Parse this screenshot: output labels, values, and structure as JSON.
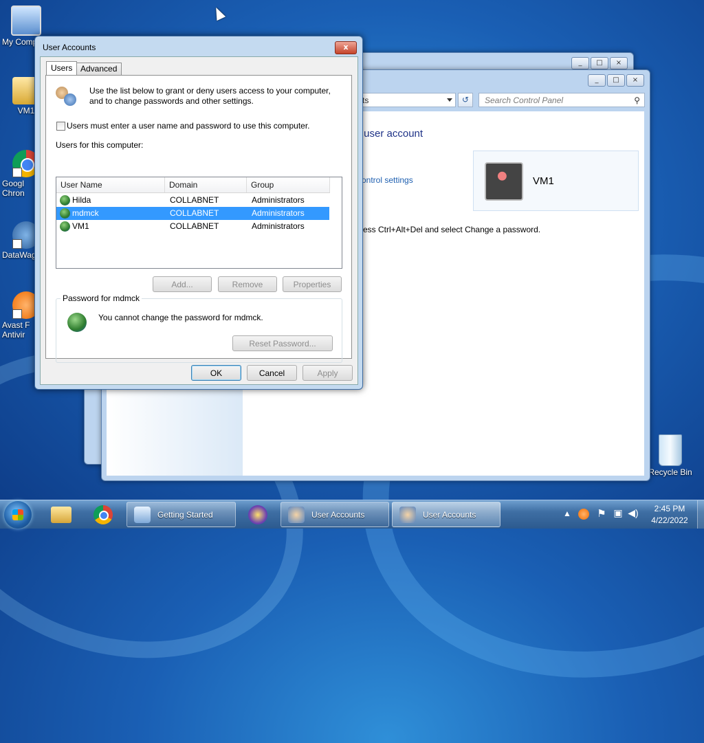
{
  "desktop": {
    "icons": [
      {
        "label": "My Comp",
        "icon": "computer-icon"
      },
      {
        "label": "VM1",
        "icon": "user-folder-icon"
      },
      {
        "label": "Google Chrom",
        "line1": "Googl",
        "line2": "Chron",
        "icon": "chrome-icon"
      },
      {
        "label": "DataWag",
        "icon": "datawag-icon"
      },
      {
        "label": "Avast F Antivir",
        "line1": "Avast F",
        "line2": "Antivir",
        "icon": "avast-icon"
      },
      {
        "label": "Recycle Bin",
        "icon": "recycle-bin-icon"
      }
    ]
  },
  "control_panel": {
    "search_placeholder": "Search Control Panel",
    "address_fragment": "ts",
    "heading_fragment": "r user account",
    "link_fragment": "ontrol settings",
    "ctrl_alt_del_text": "ress Ctrl+Alt+Del and select Change a password.",
    "account_name": "VM1"
  },
  "dialog": {
    "title": "User Accounts",
    "close_label": "x",
    "tabs": [
      {
        "label": "Users",
        "active": true
      },
      {
        "label": "Advanced",
        "active": false
      }
    ],
    "intro_line1": "Use the list below to grant or deny users access to your computer,",
    "intro_line2": "and to change passwords and other settings.",
    "must_enter_checkbox": {
      "label": "Users must enter a user name and password to use this computer.",
      "checked": false
    },
    "users_label": "Users for this computer:",
    "columns": [
      "User Name",
      "Domain",
      "Group"
    ],
    "users": [
      {
        "name": "Hilda",
        "domain": "COLLABNET",
        "group": "Administrators",
        "selected": false
      },
      {
        "name": "mdmck",
        "domain": "COLLABNET",
        "group": "Administrators",
        "selected": true
      },
      {
        "name": "VM1",
        "domain": "COLLABNET",
        "group": "Administrators",
        "selected": false
      }
    ],
    "buttons": {
      "add": "Add...",
      "remove": "Remove",
      "properties": "Properties",
      "reset_password": "Reset Password...",
      "ok": "OK",
      "cancel": "Cancel",
      "apply": "Apply"
    },
    "password_group_label": "Password for mdmck",
    "password_message": "You cannot change the password for mdmck."
  },
  "taskbar": {
    "buttons": [
      {
        "label": "Getting Started",
        "active": false
      },
      {
        "label": "User Accounts",
        "active": false
      },
      {
        "label": "User Accounts",
        "active": true
      }
    ],
    "time": "2:45 PM",
    "date": "4/22/2022"
  }
}
